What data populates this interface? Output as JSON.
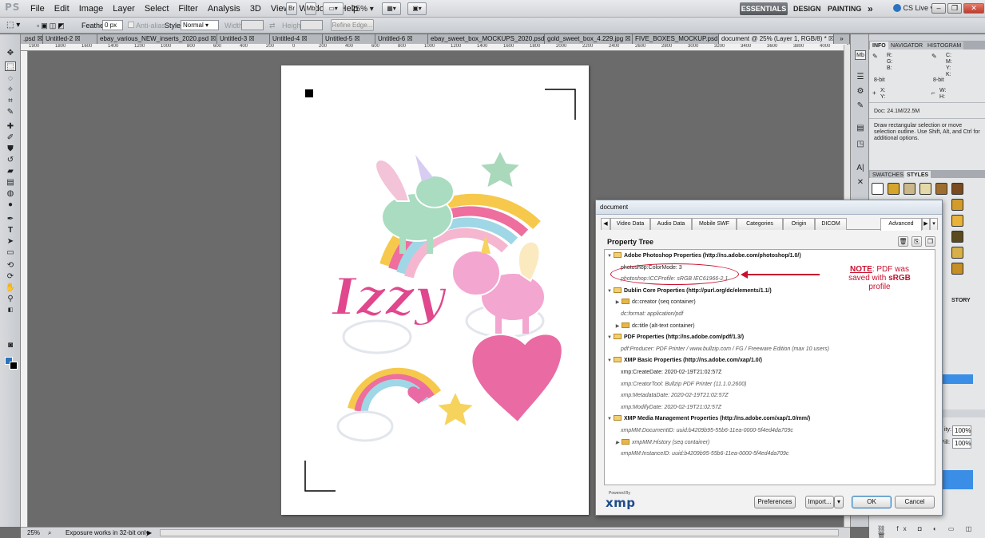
{
  "app": {
    "logo": "PS",
    "menu": [
      "File",
      "Edit",
      "Image",
      "Layer",
      "Select",
      "Filter",
      "Analysis",
      "3D",
      "View",
      "Window",
      "Help"
    ],
    "zoom": "25%",
    "workspaces": {
      "active": "ESSENTIALS",
      "design": "DESIGN",
      "painting": "PAINTING",
      "more": "»"
    },
    "cs_live": "CS Live"
  },
  "options_bar": {
    "feather_label": "Feather:",
    "feather_value": "0 px",
    "anti_alias_label": "Anti-alias",
    "style_label": "Style:",
    "style_value": "Normal",
    "width_label": "Width:",
    "height_label": "Height:",
    "refine_edge": "Refine Edge..."
  },
  "tabs": [
    {
      "label": ".psd",
      "active": false
    },
    {
      "label": "Untitled-2",
      "active": false
    },
    {
      "label": "ebay_various_NEW_inserts_2020.psd",
      "active": false
    },
    {
      "label": "Untitled-3",
      "active": false
    },
    {
      "label": "Untitled-4",
      "active": false
    },
    {
      "label": "Untitled-5",
      "active": false
    },
    {
      "label": "Untitled-6",
      "active": false
    },
    {
      "label": "ebay_sweet_box_MOCKUPS_2020.psd",
      "active": false
    },
    {
      "label": "gold_sweet_box_4.229.jpg",
      "active": false
    },
    {
      "label": "FIVE_BOXES_MOCKUP.psd",
      "active": false
    },
    {
      "label": "document @ 25% (Layer 1, RGB/8) *",
      "active": true
    }
  ],
  "ruler_ticks": [
    "1900",
    "1800",
    "1600",
    "1400",
    "1200",
    "1000",
    "800",
    "600",
    "400",
    "200",
    "0",
    "200",
    "400",
    "600",
    "800",
    "1000",
    "1200",
    "1400",
    "1600",
    "1800",
    "2000",
    "2200",
    "2400",
    "2600",
    "2800",
    "3000",
    "3200",
    "3400",
    "3600",
    "3800",
    "4000",
    "4200"
  ],
  "canvas": {
    "artwork_text": "Izzy"
  },
  "status": {
    "zoom": "25%",
    "message": "Exposure works in 32-bit only"
  },
  "info_panel": {
    "tabs": [
      "INFO",
      "NAVIGATOR",
      "HISTOGRAM"
    ],
    "r": "R:",
    "g": "G:",
    "b": "B:",
    "c": "C:",
    "m": "M:",
    "y": "Y:",
    "k": "K:",
    "bit_left": "8-bit",
    "bit_right": "8-bit",
    "x": "X:",
    "yy": "Y:",
    "w": "W:",
    "h": "H:",
    "doc": "Doc: 24.1M/22.5M",
    "hint": "Draw rectangular selection or move selection outline.  Use Shift, Alt, and Ctrl for additional options."
  },
  "swatches_panel": {
    "tabs": [
      "SWATCHES",
      "STYLES"
    ]
  },
  "history_panel": {
    "tab": "STORY"
  },
  "layers_panel": {
    "opacity_label": "ity:",
    "opacity": "100%",
    "fill_label": "Fill:",
    "fill": "100%"
  },
  "dialog": {
    "title": "document",
    "tabs": [
      "Video Data",
      "Audio Data",
      "Mobile SWF",
      "Categories",
      "Origin",
      "DICOM",
      "Advanced"
    ],
    "active_tab": "Advanced",
    "section_title": "Property Tree",
    "tree": [
      {
        "type": "head",
        "expanded": true,
        "folder": true,
        "text": "Adobe Photoshop Properties (http://ns.adobe.com/photoshop/1.0/)"
      },
      {
        "type": "leaf",
        "text": "photoshop:ColorMode: 3"
      },
      {
        "type": "leaf-it",
        "text": "photoshop:ICCProfile: sRGB IEC61966-2.1"
      },
      {
        "type": "head",
        "expanded": true,
        "folder": true,
        "text": "Dublin Core Properties (http://purl.org/dc/elements/1.1/)"
      },
      {
        "type": "node",
        "expanded": false,
        "folder": true,
        "text": "dc:creator (seq container)"
      },
      {
        "type": "leaf-it",
        "text": "dc:format: application/pdf"
      },
      {
        "type": "node",
        "expanded": false,
        "folder": true,
        "text": "dc:title (alt-text container)"
      },
      {
        "type": "head",
        "expanded": true,
        "folder": true,
        "text": "PDF Properties (http://ns.adobe.com/pdf/1.3/)"
      },
      {
        "type": "leaf-it",
        "text": "pdf:Producer: PDF Printer / www.bullzip.com / FG / Freeware Edition (max 10 users)"
      },
      {
        "type": "head",
        "expanded": true,
        "folder": true,
        "text": "XMP Basic Properties (http://ns.adobe.com/xap/1.0/)"
      },
      {
        "type": "leaf",
        "text": "xmp:CreateDate: 2020-02-19T21:02:57Z"
      },
      {
        "type": "leaf-it",
        "text": "xmp:CreatorTool: Bullzip PDF Printer (11.1.0.2600)"
      },
      {
        "type": "leaf-it",
        "text": "xmp:MetadataDate: 2020-02-19T21:02:57Z"
      },
      {
        "type": "leaf-it",
        "text": "xmp:ModifyDate: 2020-02-19T21:02:57Z"
      },
      {
        "type": "head",
        "expanded": true,
        "folder": true,
        "text": "XMP Media Management Properties (http://ns.adobe.com/xap/1.0/mm/)"
      },
      {
        "type": "leaf-it",
        "text": "xmpMM:DocumentID: uuid:b4209b95-55b6-11ea-0000-5f4ed4da709c"
      },
      {
        "type": "node-it",
        "expanded": false,
        "folder": true,
        "text": "xmpMM:History (seq container)"
      },
      {
        "type": "leaf-it",
        "text": "xmpMM:InstanceID: uuid:b4209b95-55b6-11ea-0000-5f4ed4da709c"
      }
    ],
    "note": {
      "label": "NOTE",
      "line1": ": PDF was",
      "line2_pre": "saved with ",
      "line2_bold": "sRGB",
      "line3": "profile"
    },
    "powered_by": "Powered By",
    "xmp_logo": "xmp",
    "preferences": "Preferences",
    "import": "Import...",
    "ok": "OK",
    "cancel": "Cancel"
  },
  "colors": {
    "note_red": "#c8102e",
    "ps_blue": "#2b72c0",
    "xmp_blue": "#1d4c8c"
  }
}
